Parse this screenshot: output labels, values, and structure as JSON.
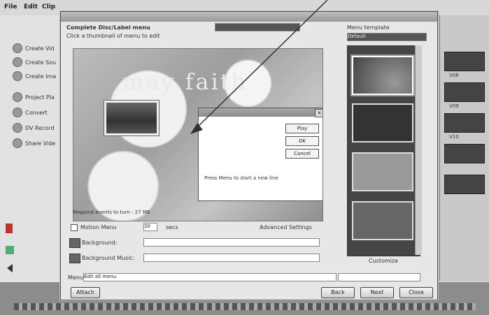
{
  "menubar": {
    "file": "File",
    "edit": "Edit",
    "clip": "Clip"
  },
  "left_panel": {
    "items": [
      "Create Vid",
      "Create Sou",
      "Create Ima",
      "Project Pla",
      "Convert",
      "DV Record",
      "Share Vide"
    ]
  },
  "dialog": {
    "title": "Complete Disc/Label menu",
    "instruction": "Click a thumbnail of menu to edit",
    "preview_text": "may faith",
    "thumbnail_caption": "",
    "popup": {
      "buttons": [
        "Play",
        "OK",
        "Cancel"
      ],
      "message": "Press Menu to start a new line"
    },
    "status_text": "Respond events to turn - 27 MB",
    "motion_menu_label": "Motion Menu",
    "seconds_value": "30",
    "secs_label": "secs",
    "advanced_button": "Advanced Settings",
    "background_label": "Background:",
    "background_music_label": "Background Music:",
    "menu_label": "Menu:",
    "menu_value": "Edit all menu",
    "template_header": "Menu template",
    "template_select": "Default",
    "customize_button": "Customize",
    "footer_buttons": {
      "next": "Next",
      "back": "Back",
      "close": "Close"
    },
    "attach": "Attach"
  },
  "right_strip": {
    "labels": [
      "V08",
      "V09",
      "V10"
    ]
  }
}
